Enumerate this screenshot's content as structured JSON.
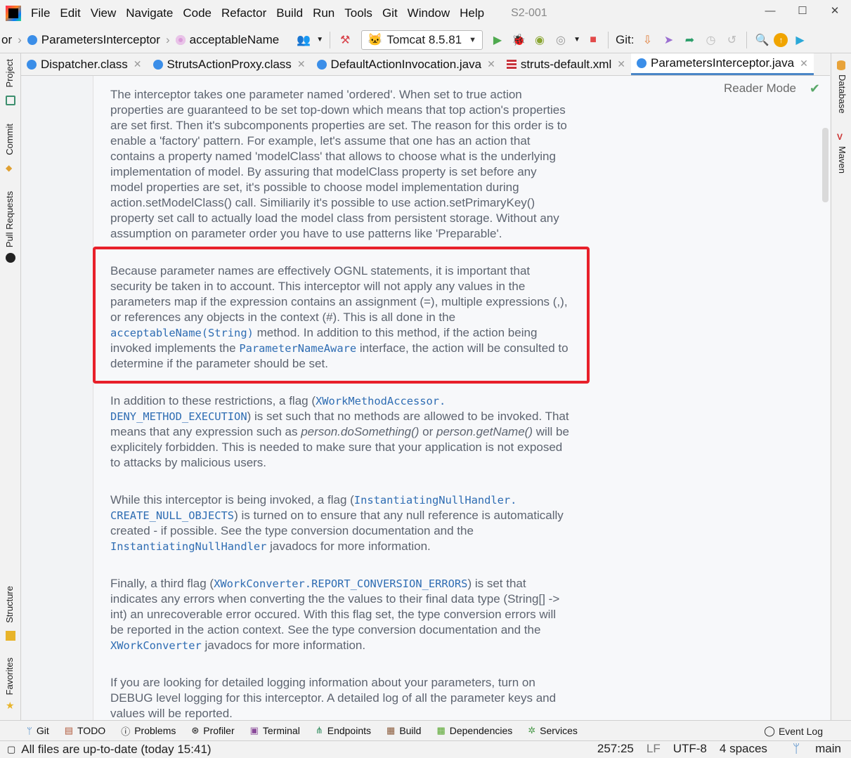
{
  "menubar": {
    "items": [
      "File",
      "Edit",
      "View",
      "Navigate",
      "Code",
      "Refactor",
      "Build",
      "Run",
      "Tools",
      "Git",
      "Window",
      "Help"
    ],
    "project": "S2-001",
    "window_controls": [
      "—",
      "☐",
      "✕"
    ]
  },
  "toolbar": {
    "crumb_prefix": "or",
    "breadcrumb_class": "ParametersInterceptor",
    "breadcrumb_member": "acceptableName",
    "run_config": "Tomcat 8.5.81",
    "git_label": "Git:"
  },
  "tabs": [
    {
      "label": "Dispatcher.class",
      "icon": "class-icon",
      "active": false
    },
    {
      "label": "StrutsActionProxy.class",
      "icon": "class-icon",
      "active": false
    },
    {
      "label": "DefaultActionInvocation.java",
      "icon": "class-icon",
      "active": false
    },
    {
      "label": "struts-default.xml",
      "icon": "xml-icon",
      "active": false
    },
    {
      "label": "ParametersInterceptor.java",
      "icon": "class-icon",
      "active": true
    }
  ],
  "left_tools": [
    "Project",
    "Commit",
    "Pull Requests",
    "Structure",
    "Favorites"
  ],
  "right_tools": [
    "Database",
    "Maven"
  ],
  "editor": {
    "reader_mode": "Reader Mode",
    "para1": "The interceptor takes one parameter named 'ordered'. When set to true action properties are guaranteed to be set top-down which means that top action's properties are set first. Then it's subcomponents properties are set. The reason for this order is to enable a 'factory' pattern. For example, let's assume that one has an action that contains a property named 'modelClass' that allows to choose what is the underlying implementation of model. By assuring that modelClass property is set before any model properties are set, it's possible to choose model implementation during action.setModelClass() call. Similiarily it's possible to use action.setPrimaryKey() property set call to actually load the model class from persistent storage. Without any assumption on parameter order you have to use patterns like 'Preparable'.",
    "para2": {
      "t1": "Because parameter names are effectively OGNL statements, it is important that security be taken in to account. This interceptor will not apply any values in the parameters map if the expression contains an assignment (=), multiple expressions (,), or references any objects in the context (#). This is all done in the ",
      "c1": "acceptableName(String)",
      "t2": " method. In addition to this method, if the action being invoked implements the ",
      "c2": "ParameterNameAware",
      "t3": " interface, the action will be consulted to determine if the parameter should be set."
    },
    "para3": {
      "t1": "In addition to these restrictions, a flag (",
      "c1": "XWorkMethodAccessor.",
      "c1b": "DENY_METHOD_EXECUTION",
      "t2": ") is set such that no methods are allowed to be invoked. That means that any expression such as ",
      "e1": "person.doSomething()",
      "t3": " or ",
      "e2": "person.getName()",
      "t4": " will be explicitely forbidden. This is needed to make sure that your application is not exposed to attacks by malicious users."
    },
    "para4": {
      "t1": "While this interceptor is being invoked, a flag (",
      "c1": "InstantiatingNullHandler.",
      "c1b": "CREATE_NULL_OBJECTS",
      "t2": ") is turned on to ensure that any null reference is automatically created - if possible. See the type conversion documentation and the ",
      "c2": "InstantiatingNullHandler",
      "t3": " javadocs for more information."
    },
    "para5": {
      "t1": "Finally, a third flag (",
      "c1": "XWorkConverter.REPORT_CONVERSION_ERRORS",
      "t2": ") is set that indicates any errors when converting the the values to their final data type (String[] -> int) an unrecoverable error occured. With this flag set, the type conversion errors will be reported in the action context. See the type conversion documentation and the ",
      "c2": "XWorkConverter",
      "t3": " javadocs for more information."
    },
    "para6": "If you are looking for detailed logging information about your parameters, turn on DEBUG level logging for this interceptor. A detailed log of all the parameter keys and values will be reported."
  },
  "bottom_tools": [
    {
      "label": "Git",
      "icon": "git-branch-icon"
    },
    {
      "label": "TODO",
      "icon": "todo-icon"
    },
    {
      "label": "Problems",
      "icon": "problems-icon"
    },
    {
      "label": "Profiler",
      "icon": "profiler-icon"
    },
    {
      "label": "Terminal",
      "icon": "terminal-icon"
    },
    {
      "label": "Endpoints",
      "icon": "endpoints-icon"
    },
    {
      "label": "Build",
      "icon": "build-icon"
    },
    {
      "label": "Dependencies",
      "icon": "dependencies-icon"
    },
    {
      "label": "Services",
      "icon": "services-icon"
    }
  ],
  "event_log": "Event Log",
  "status": {
    "message": "All files are up-to-date (today 15:41)",
    "position": "257:25",
    "line_sep": "LF",
    "encoding": "UTF-8",
    "indent": "4 spaces",
    "branch": "main"
  },
  "colors": {
    "highlight_box": "#e8202a",
    "link_code": "#2f6db3",
    "doc_text": "#5d6470"
  }
}
